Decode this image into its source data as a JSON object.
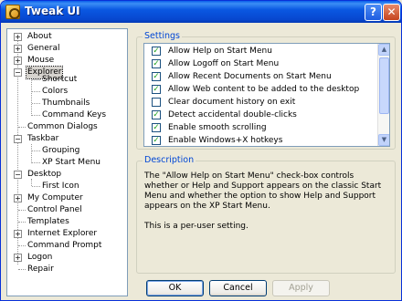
{
  "window": {
    "title": "Tweak UI"
  },
  "titlebar": {
    "help_glyph": "?",
    "close_glyph": "✕"
  },
  "tree": {
    "items": [
      {
        "label": "About",
        "expander": "+"
      },
      {
        "label": "General",
        "expander": "+"
      },
      {
        "label": "Mouse",
        "expander": "+"
      },
      {
        "label": "Explorer",
        "expander": "−",
        "selected": true
      },
      {
        "label": "Shortcut"
      },
      {
        "label": "Colors"
      },
      {
        "label": "Thumbnails"
      },
      {
        "label": "Command Keys"
      },
      {
        "label": "Common Dialogs"
      },
      {
        "label": "Taskbar",
        "expander": "−"
      },
      {
        "label": "Grouping"
      },
      {
        "label": "XP Start Menu"
      },
      {
        "label": "Desktop",
        "expander": "−"
      },
      {
        "label": "First Icon"
      },
      {
        "label": "My Computer",
        "expander": "+"
      },
      {
        "label": "Control Panel"
      },
      {
        "label": "Templates"
      },
      {
        "label": "Internet Explorer",
        "expander": "+"
      },
      {
        "label": "Command Prompt"
      },
      {
        "label": "Logon",
        "expander": "+"
      },
      {
        "label": "Repair"
      }
    ]
  },
  "settings": {
    "title": "Settings",
    "items": [
      {
        "label": "Allow Help on Start Menu",
        "checked": "✓"
      },
      {
        "label": "Allow Logoff on Start Menu",
        "checked": "✓"
      },
      {
        "label": "Allow Recent Documents on Start Menu",
        "checked": "✓"
      },
      {
        "label": "Allow Web content to be added to the desktop",
        "checked": "✓"
      },
      {
        "label": "Clear document history on exit",
        "checked": ""
      },
      {
        "label": "Detect accidental double-clicks",
        "checked": "✓"
      },
      {
        "label": "Enable smooth scrolling",
        "checked": "✓"
      },
      {
        "label": "Enable Windows+X hotkeys",
        "checked": "✓"
      }
    ]
  },
  "description": {
    "title": "Description",
    "paragraph1": "The \"Allow Help on Start Menu\" check-box controls whether or Help and Support appears on the classic Start Menu and whether the option to show Help and Support appears on the XP Start Menu.",
    "paragraph2": "This is a per-user setting."
  },
  "buttons": {
    "ok": "OK",
    "cancel": "Cancel",
    "apply": "Apply"
  }
}
